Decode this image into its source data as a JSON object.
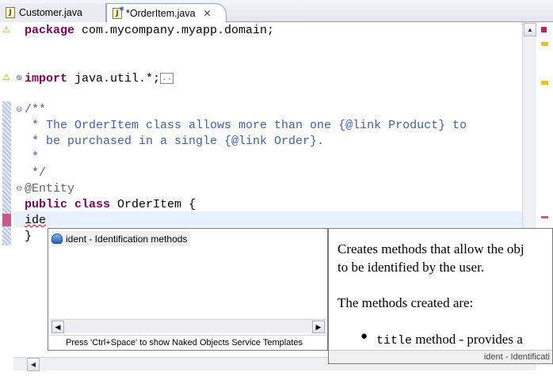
{
  "tabs": [
    {
      "label": "Customer.java",
      "icon": "java-file-icon"
    },
    {
      "label": "*OrderItem.java",
      "icon": "java-file-icon",
      "close": "✕"
    }
  ],
  "code": {
    "line_package_kw": "package",
    "line_package_rest": " com.mycompany.myapp.domain;",
    "line_import_kw": "import",
    "line_import_rest": " java.util.*;",
    "line_import_folded": "..",
    "javadoc": [
      "/**",
      " * The OrderItem class allows more than one {@link Product} to",
      " * be purchased in a single {@link Order}.",
      " *",
      " */"
    ],
    "annotation": "@Entity",
    "class_kw1": "public",
    "class_kw2": "class",
    "class_rest": " OrderItem {",
    "typed": "ide",
    "closing_brace": "}"
  },
  "assist": {
    "proposal": "ident - Identification methods",
    "status": "Press 'Ctrl+Space' to show Naked Objects Service Templates"
  },
  "doc": {
    "line1": "Creates methods that allow the obj",
    "line2": "to be identified by the user.",
    "line3": "The methods created are:",
    "bullet_mono": "title",
    "bullet_text": " method - provides a",
    "footer": "ident - Identificati"
  },
  "colors": {
    "keyword": "#7f0055",
    "javadoc": "#3f5fbf",
    "annotation": "#646464",
    "current_line": "#e8f2fe"
  }
}
